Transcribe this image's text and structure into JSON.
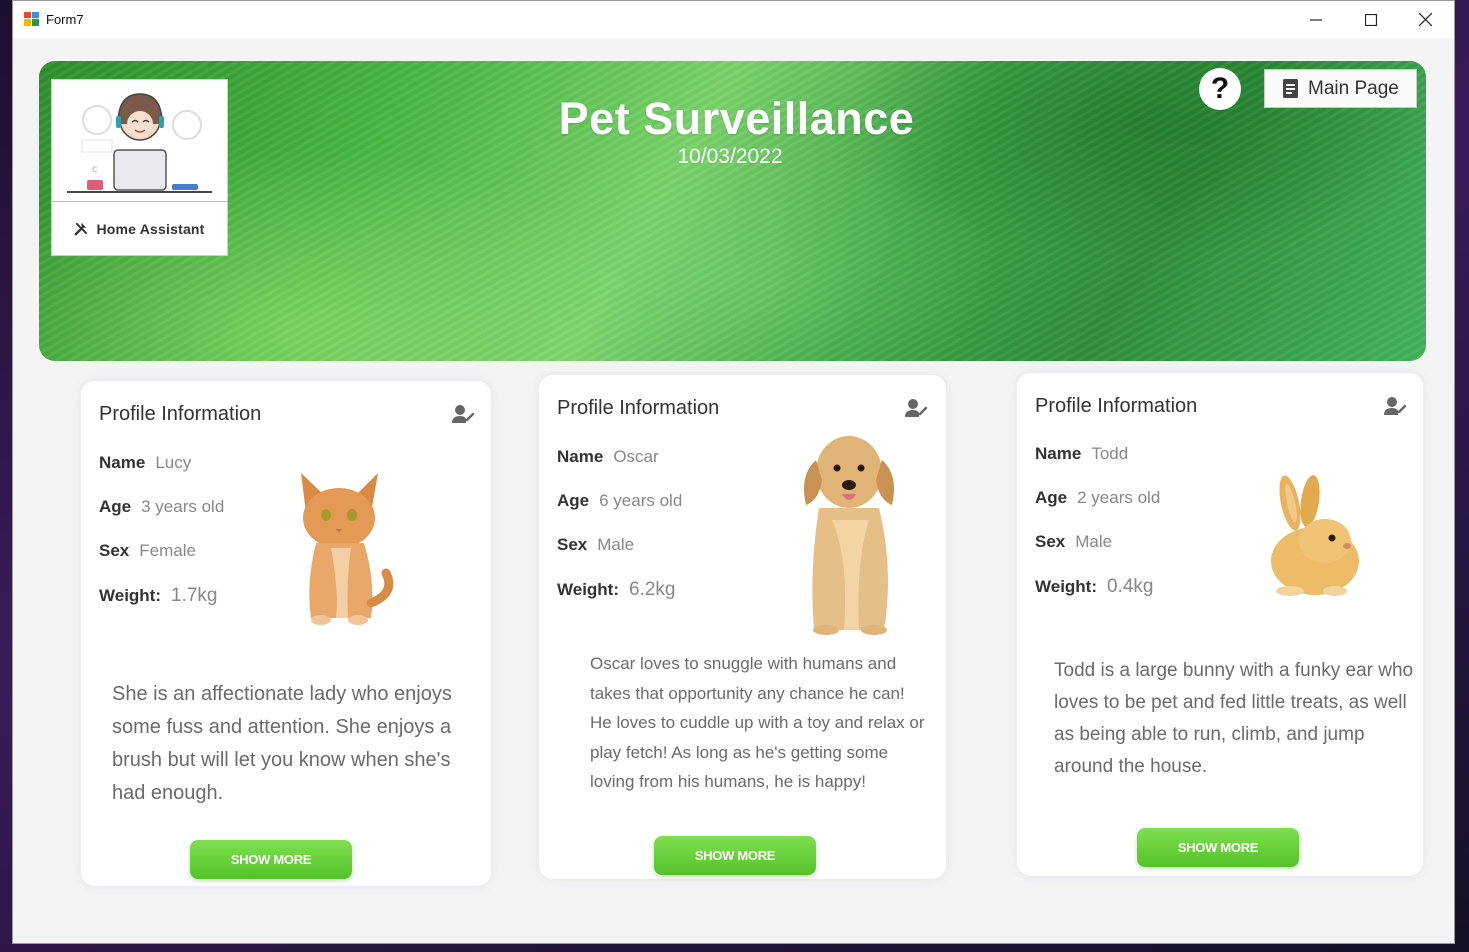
{
  "window": {
    "title": "Form7"
  },
  "header": {
    "title": "Pet Surveillance",
    "date": "10/03/2022",
    "assistant_label": "Home Assistant",
    "main_page_label": "Main Page",
    "help_label": "?"
  },
  "cards": [
    {
      "heading": "Profile Information",
      "name_label": "Name",
      "name": "Lucy",
      "age_label": "Age",
      "age": "3 years old",
      "sex_label": "Sex",
      "sex": "Female",
      "weight_label": "Weight:",
      "weight": "1.7kg",
      "description": "She is an affectionate lady who enjoys some fuss and attention. She enjoys a brush but will let you know when she's had enough.",
      "button": "SHOW MORE",
      "pet_icon": "cat-photo"
    },
    {
      "heading": "Profile Information",
      "name_label": "Name",
      "name": "Oscar",
      "age_label": "Age",
      "age": "6 years old",
      "sex_label": "Sex",
      "sex": "Male",
      "weight_label": "Weight:",
      "weight": "6.2kg",
      "description": "Oscar loves to snuggle with humans and takes that opportunity any chance he can! He loves to cuddle up with a toy and relax or play fetch! As long as he's getting some loving from his humans, he is happy!",
      "button": "SHOW MORE",
      "pet_icon": "dog-photo"
    },
    {
      "heading": "Profile Information",
      "name_label": "Name",
      "name": "Todd",
      "age_label": "Age",
      "age": "2 years old",
      "sex_label": "Sex",
      "sex": "Male",
      "weight_label": "Weight:",
      "weight": "0.4kg",
      "description": "Todd is a large bunny with a funky ear who loves to be pet and fed little treats, as well as being able to run, climb, and jump around the house.",
      "button": "SHOW MORE",
      "pet_icon": "rabbit-photo"
    }
  ],
  "colors": {
    "accent_green": "#54c22a",
    "banner_green": "#3fa548"
  }
}
